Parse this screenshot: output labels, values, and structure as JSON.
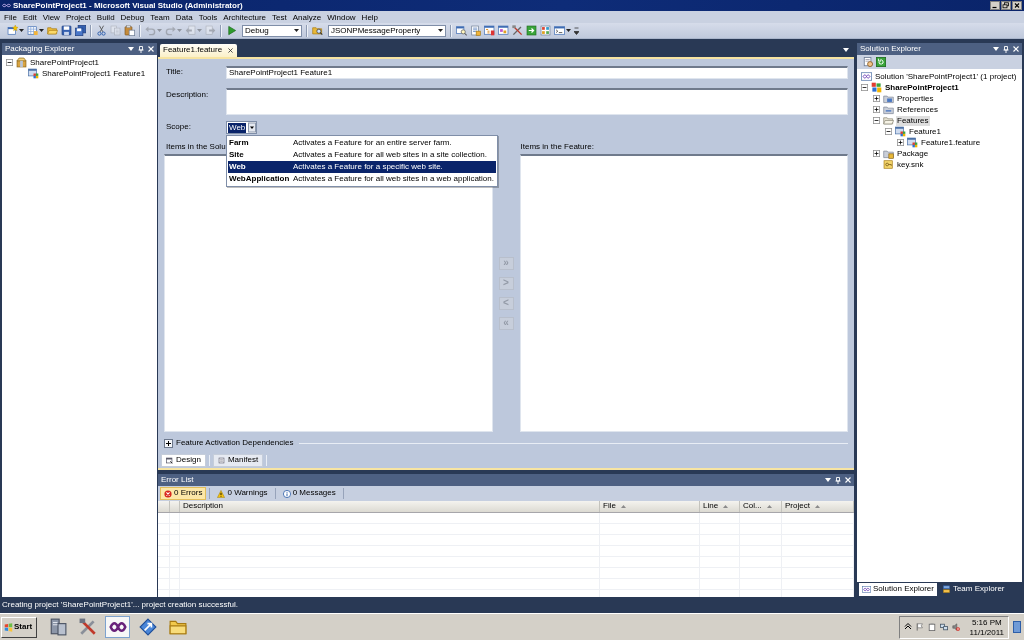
{
  "window": {
    "title": "SharePointProject1 - Microsoft Visual Studio (Administrator)"
  },
  "menu": [
    "File",
    "Edit",
    "View",
    "Project",
    "Build",
    "Debug",
    "Team",
    "Data",
    "Tools",
    "Architecture",
    "Test",
    "Analyze",
    "Window",
    "Help"
  ],
  "toolbar": {
    "groups": [
      {
        "buttons": [
          {
            "kind": "new-project",
            "dropdown": true,
            "disabled": false
          },
          {
            "kind": "add-item",
            "dropdown": true,
            "disabled": false
          },
          {
            "kind": "open",
            "dropdown": false,
            "disabled": false
          },
          {
            "kind": "save",
            "dropdown": false,
            "disabled": false
          },
          {
            "kind": "save-all",
            "dropdown": false,
            "disabled": false
          }
        ]
      },
      {
        "buttons": [
          {
            "kind": "cut",
            "dropdown": false,
            "disabled": false
          },
          {
            "kind": "copy",
            "dropdown": false,
            "disabled": true
          },
          {
            "kind": "paste",
            "dropdown": false,
            "disabled": false
          }
        ]
      },
      {
        "buttons": [
          {
            "kind": "undo",
            "dropdown": true,
            "disabled": true
          },
          {
            "kind": "redo",
            "dropdown": true,
            "disabled": true
          },
          {
            "kind": "back",
            "dropdown": true,
            "disabled": true
          },
          {
            "kind": "forward",
            "dropdown": false,
            "disabled": true
          }
        ]
      },
      {
        "buttons": [
          {
            "kind": "start",
            "dropdown": false,
            "disabled": false
          }
        ],
        "combo": "Debug"
      },
      {
        "buttons": [
          {
            "kind": "find-in-files",
            "dropdown": false,
            "disabled": false
          }
        ],
        "combo": "JSONPMessageProperty"
      },
      {
        "buttons": [
          {
            "kind": "find",
            "dropdown": false,
            "disabled": false
          },
          {
            "kind": "properties",
            "dropdown": false,
            "disabled": false
          },
          {
            "kind": "explorer",
            "dropdown": false,
            "disabled": false
          },
          {
            "kind": "class-view",
            "dropdown": false,
            "disabled": false
          },
          {
            "kind": "toolbox",
            "dropdown": false,
            "disabled": false
          },
          {
            "kind": "extensions",
            "dropdown": false,
            "disabled": false
          },
          {
            "kind": "object-browser",
            "dropdown": false,
            "disabled": false
          },
          {
            "kind": "command",
            "dropdown": true,
            "disabled": false
          }
        ]
      }
    ]
  },
  "packaging_explorer": {
    "title": "Packaging Explorer",
    "tree": [
      {
        "kind": "package",
        "label": "SharePointProject1",
        "expanded": true,
        "selected": false,
        "children": [
          {
            "kind": "feature",
            "label": "SharePointProject1 Feature1",
            "selected": false
          }
        ]
      }
    ]
  },
  "document_tabs": [
    {
      "label": "Feature1.feature",
      "selected": true
    }
  ],
  "feature_designer": {
    "fields": [
      {
        "kind": "single-line",
        "label": "Title:",
        "value": "SharePointProject1 Feature1"
      },
      {
        "kind": "multi-line",
        "label": "Description:"
      }
    ],
    "scope": {
      "label": "Scope:",
      "value": "Web",
      "expanded": true,
      "options": [
        {
          "name": "Farm",
          "description": "Activates a Feature for an entire server farm.",
          "selected": false
        },
        {
          "name": "Site",
          "description": "Activates a Feature for all web sites in a site collection.",
          "selected": false
        },
        {
          "name": "Web",
          "description": "Activates a Feature for a specific web site.",
          "selected": true
        },
        {
          "name": "WebApplication",
          "description": "Activates a Feature for all web sites in a web application.",
          "selected": false
        }
      ]
    },
    "solution_items_label": "Items in the Solu",
    "feature_items_label": "Items in the Feature:",
    "move_buttons": [
      {
        "label": "»",
        "disabled": true
      },
      {
        "label": ">",
        "disabled": true
      },
      {
        "label": "<",
        "disabled": true
      },
      {
        "label": "«",
        "disabled": true
      }
    ],
    "dependencies": {
      "label": "Feature Activation Dependencies",
      "expanded": false
    },
    "view_tabs": [
      {
        "kind": "design",
        "label": "Design",
        "selected": true
      },
      {
        "kind": "manifest",
        "label": "Manifest",
        "selected": false
      }
    ]
  },
  "error_list": {
    "title": "Error List",
    "filters": [
      {
        "kind": "error",
        "label": "0 Errors",
        "selected": true
      },
      {
        "kind": "warning",
        "label": "0 Warnings",
        "selected": false
      },
      {
        "kind": "message",
        "label": "0 Messages",
        "selected": false
      }
    ],
    "columns": [
      {
        "label": "Description",
        "sort_arrow": false
      },
      {
        "label": "File",
        "sort_arrow": true
      },
      {
        "label": "Line",
        "sort_arrow": true
      },
      {
        "label": "Col...",
        "sort_arrow": true
      },
      {
        "label": "Project",
        "sort_arrow": true
      }
    ]
  },
  "solution_explorer": {
    "title": "Solution Explorer",
    "solution": {
      "label": "Solution 'SharePointProject1' (1 project)",
      "selected": false
    },
    "tree": [
      {
        "kind": "project",
        "label": "SharePointProject1",
        "expanded": true,
        "selected": false,
        "children": [
          {
            "kind": "properties",
            "label": "Properties",
            "expanded": false,
            "selected": false
          },
          {
            "kind": "references",
            "label": "References",
            "expanded": false,
            "selected": false
          },
          {
            "kind": "folder",
            "label": "Features",
            "expanded": true,
            "selected": true,
            "children": [
              {
                "kind": "feature",
                "label": "Feature1",
                "expanded": true,
                "selected": false,
                "children": [
                  {
                    "kind": "feature",
                    "label": "Feature1.feature",
                    "expanded": false,
                    "selected": false
                  }
                ]
              }
            ]
          },
          {
            "kind": "package-folder",
            "label": "Package",
            "expanded": false,
            "selected": false
          },
          {
            "kind": "key",
            "label": "key.snk",
            "selected": false
          }
        ]
      }
    ]
  },
  "explorer_tabs": [
    {
      "kind": "solution",
      "label": "Solution Explorer",
      "selected": true
    },
    {
      "kind": "team",
      "label": "Team Explorer",
      "selected": false
    }
  ],
  "status_bar": "Creating project 'SharePointProject1'... project creation successful.",
  "taskbar": {
    "start": "Start",
    "apps": [
      {
        "kind": "server",
        "selected": false
      },
      {
        "kind": "tools",
        "selected": false
      },
      {
        "kind": "studio",
        "selected": true
      },
      {
        "kind": "remote",
        "selected": false
      },
      {
        "kind": "explorer",
        "selected": false
      }
    ],
    "clock": {
      "time": "5:16 PM",
      "date": "11/1/2011"
    }
  }
}
